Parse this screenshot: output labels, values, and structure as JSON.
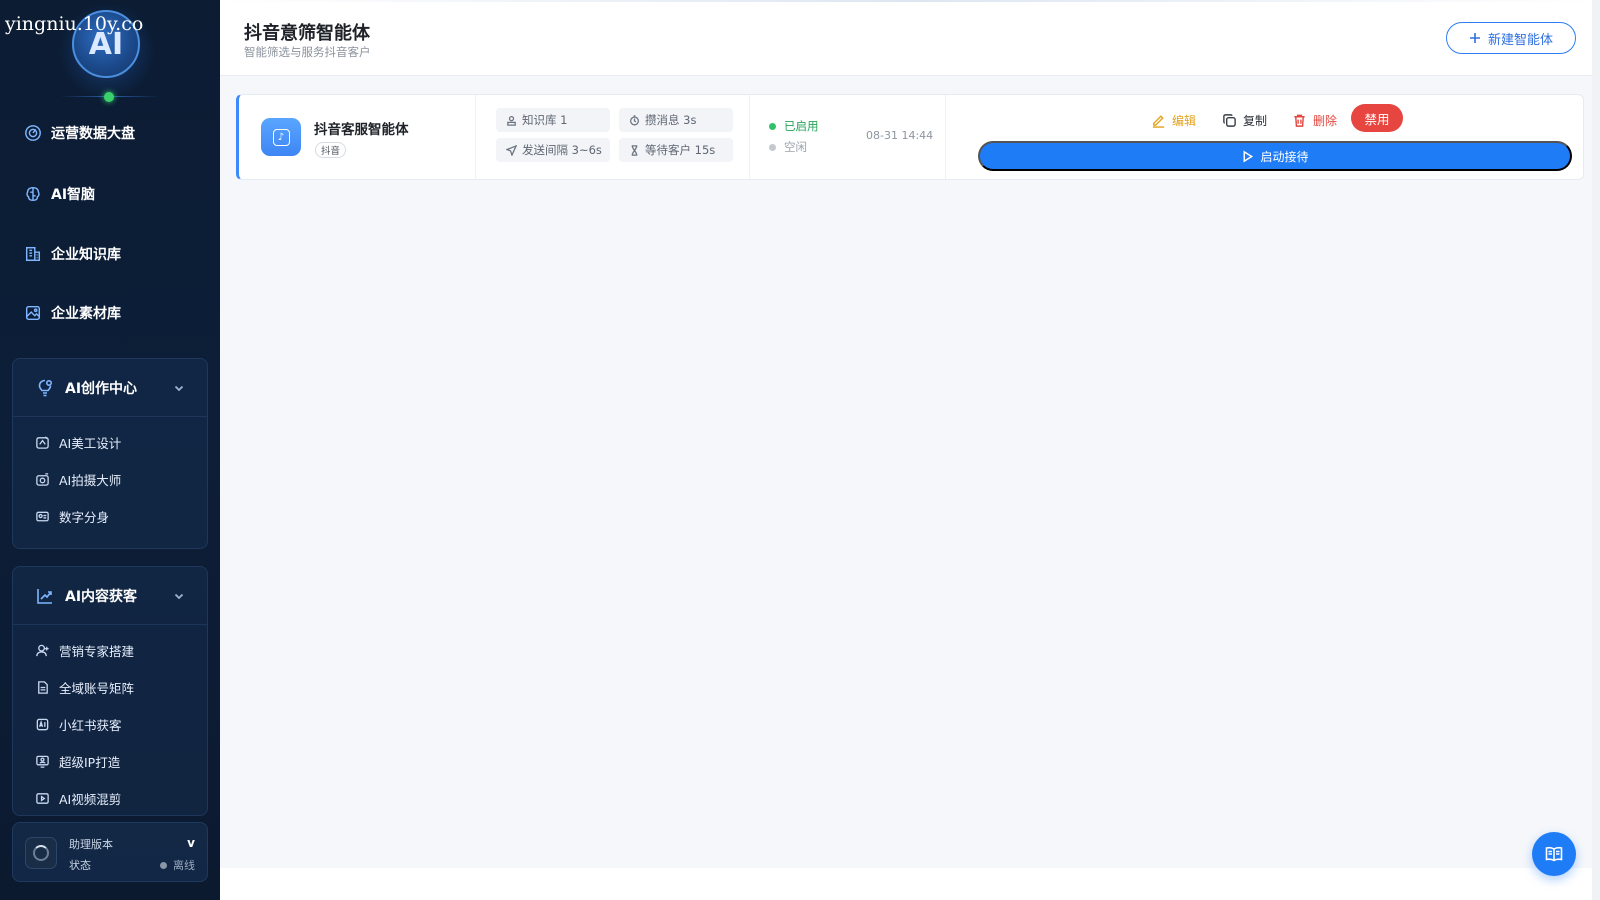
{
  "watermark": "yingniu.10y.co",
  "logo": {
    "text": "AI"
  },
  "sidebar": {
    "nav": [
      {
        "label": "运营数据大盘",
        "icon": "dashboard-icon"
      },
      {
        "label": "AI智脑",
        "icon": "brain-icon"
      },
      {
        "label": "企业知识库",
        "icon": "building-icon"
      },
      {
        "label": "企业素材库",
        "icon": "image-icon"
      }
    ],
    "groups": [
      {
        "title": "AI创作中心",
        "icon": "bulb-gear-icon",
        "items": [
          {
            "label": "AI美工设计",
            "icon": "design-icon"
          },
          {
            "label": "AI拍摄大师",
            "icon": "camera-icon"
          },
          {
            "label": "数字分身",
            "icon": "id-card-icon"
          }
        ]
      },
      {
        "title": "AI内容获客",
        "icon": "trend-icon",
        "items": [
          {
            "label": "营销专家搭建",
            "icon": "user-icon"
          },
          {
            "label": "全域账号矩阵",
            "icon": "document-icon"
          },
          {
            "label": "小红书获客",
            "icon": "ai-badge-icon"
          },
          {
            "label": "超级IP打造",
            "icon": "monitor-user-icon"
          },
          {
            "label": "AI视频混剪",
            "icon": "video-icon"
          }
        ]
      }
    ],
    "assistant": {
      "version_label": "助理版本",
      "version_value": "v",
      "status_label": "状态",
      "status_value": "离线"
    }
  },
  "header": {
    "title": "抖音意筛智能体",
    "subtitle": "智能筛选与服务抖音客户",
    "new_button": "新建智能体"
  },
  "agents": [
    {
      "name": "抖音客服智能体",
      "tag": "抖音",
      "stats": {
        "knowledge": "知识库 1",
        "merge": "攒消息 3s",
        "interval": "发送间隔 3~6s",
        "wait": "等待客户 15s"
      },
      "status_enabled": "已启用",
      "status_idle": "空闲",
      "timestamp": "08-31 14:44",
      "actions": {
        "edit": "编辑",
        "copy": "复制",
        "delete": "删除",
        "disable": "禁用",
        "start": "启动接待"
      }
    }
  ],
  "colors": {
    "accent": "#1f7cf7",
    "success": "#25a35a",
    "danger": "#e74540",
    "warning": "#e3a21a",
    "sidebar_bg": "#0b1c33"
  }
}
